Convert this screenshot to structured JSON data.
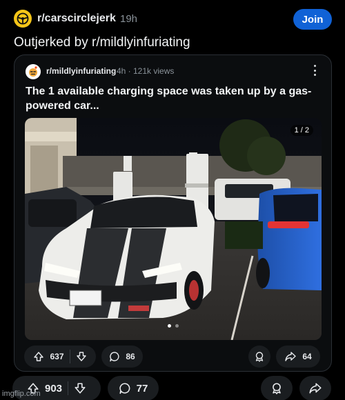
{
  "header": {
    "subreddit": "r/carscirclejerk",
    "age": "19h",
    "join_label": "Join",
    "avatar_icon": "steering-wheel-icon"
  },
  "post": {
    "title": "Outjerked by r/mildlyinfuriating"
  },
  "crosspost": {
    "subreddit": "r/mildlyinfuriating",
    "meta": "4h · 121k views",
    "title": "The 1 available charging space was taken up by a gas-powered car...",
    "image": {
      "counter": "1 / 2",
      "page_count": 2,
      "current_page": 1,
      "description_icon": "photo-icon"
    },
    "actions": {
      "upvotes": "637",
      "comments": "86",
      "shares": "64"
    }
  },
  "actions": {
    "upvotes": "903",
    "comments": "77"
  },
  "watermark": "imgflip.com",
  "colors": {
    "background": "#000000",
    "join_button": "#1062d6",
    "pill": "#1a1d20",
    "avatar_yellow": "#f5c518"
  }
}
